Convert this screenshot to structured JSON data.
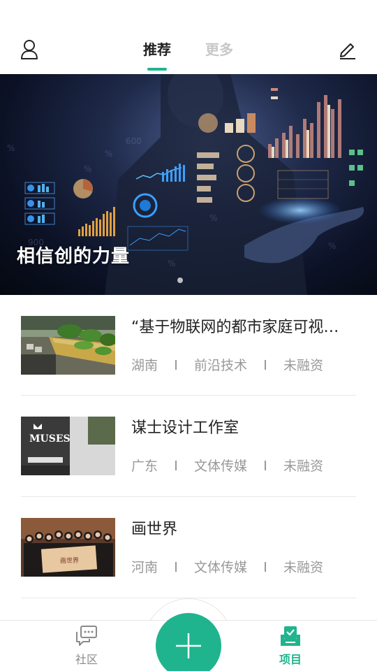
{
  "header": {
    "tabs": [
      {
        "label": "推荐",
        "active": true
      },
      {
        "label": "更多",
        "active": false
      }
    ],
    "left_icon": "user-icon",
    "right_icon": "edit-icon"
  },
  "banner": {
    "title": "相信创的力量",
    "page_count": 1,
    "current_page": 1
  },
  "projects": [
    {
      "title": "“基于物联网的都市家庭可视…",
      "region": "湖南",
      "category": "前沿技术",
      "funding": "未融资"
    },
    {
      "title": "谋士设计工作室",
      "region": "广东",
      "category": "文体传媒",
      "funding": "未融资"
    },
    {
      "title": "画世界",
      "region": "河南",
      "category": "文体传媒",
      "funding": "未融资"
    }
  ],
  "bottom_nav": {
    "community_label": "社区",
    "projects_label": "项目",
    "fab_icon": "plus-icon"
  },
  "colors": {
    "accent": "#1fb48e",
    "inactive_tab": "#c8c8c8",
    "meta_text": "#999999"
  }
}
